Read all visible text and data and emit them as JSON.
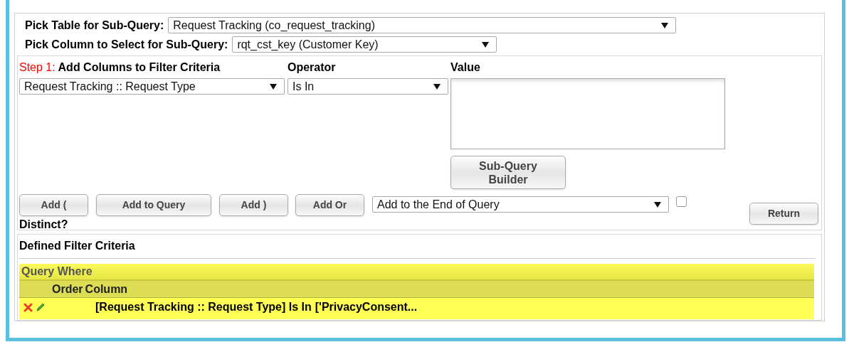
{
  "pick_table": {
    "label": "Pick Table for Sub-Query:",
    "value": "Request Tracking (co_request_tracking)"
  },
  "pick_column": {
    "label": "Pick Column to Select for Sub-Query:",
    "value": "rqt_cst_key (Customer Key)"
  },
  "step": {
    "prefix": "Step 1:",
    "label": "Add Columns to Filter Criteria"
  },
  "operator_label": "Operator",
  "value_label": "Value",
  "column_select": "Request Tracking :: Request Type",
  "operator_select": "Is In",
  "subquery_button": "Sub-Query Builder",
  "buttons": [
    "Add (",
    "Add to Query",
    "Add )",
    "Add Or"
  ],
  "position_select": "Add to the End of Query",
  "distinct": {
    "label": "Distinct?",
    "checked": false
  },
  "return_button": "Return",
  "defined": {
    "title": "Defined Filter Criteria",
    "table_title": "Query Where",
    "columns": [
      "Order",
      "Column"
    ],
    "rows": [
      {
        "order": "",
        "criteria": "[Request Tracking :: Request Type] Is In",
        "value": "['PrivacyConsent..."
      }
    ]
  }
}
